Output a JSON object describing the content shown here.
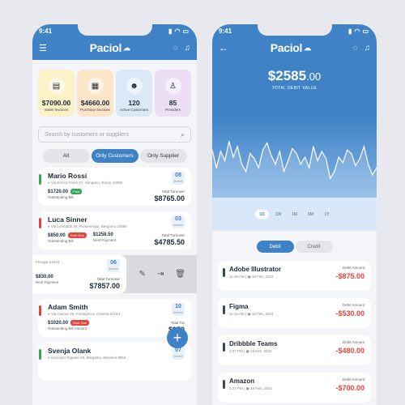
{
  "status_time": "9:41",
  "app_name": "Paciol",
  "tiles": [
    {
      "value": "$7090.00",
      "label": "Sales Invoices",
      "bg": "#fbf2c8"
    },
    {
      "value": "$4660.00",
      "label": "Purchase Invoices",
      "bg": "#fbe4c8"
    },
    {
      "value": "120",
      "label": "Active Customers",
      "bg": "#dbe8f7"
    },
    {
      "value": "85",
      "label": "Providers",
      "bg": "#ecdef5"
    }
  ],
  "search_placeholder": "Search by customers or suppliers",
  "segments": [
    "All",
    "Only Customers",
    "Only Supplier"
  ],
  "customers": [
    {
      "name": "Mario Rossi",
      "addr": "Via Enrico Fermi 67, Sangano, Torino 10090",
      "amount": "$1720.00",
      "status": "Paid",
      "sub": "Outstanding Bill",
      "day": "08",
      "mon": "Invoice",
      "total_label": "Total Turnover",
      "total": "$8765.00"
    },
    {
      "name": "Luca Sinner",
      "addr": "Via Lombardi 38, Pumenengo, Bergamo 24050",
      "amount": "$850.00",
      "status": "Over Due",
      "sub": "Outstanding Bill",
      "amount2": "$1258.50",
      "sub2": "Next Payment",
      "day": "03",
      "mon": "Invoice",
      "total_label": "Total Turnover",
      "total": "$4785.50"
    },
    {
      "addr": "Perugia 61033",
      "amount": "$830.00",
      "sub": "Next Payment",
      "day": "06",
      "mon": "Invoice",
      "total_label": "Total Turnover",
      "total": "$7857.00"
    },
    {
      "name": "Adam Smith",
      "addr": "Via Cavour 25, Fontegreca, Caserta 81014",
      "amount": "$1020.00",
      "status": "Over Due",
      "sub": "Outstanding Bill Amount",
      "day": "10",
      "mon": "Invoice",
      "total_label": "Total Tur",
      "total": "$970"
    },
    {
      "name": "Svenja Olank",
      "addr": "Giacomo Gigante 58, Bergamo, Messina 9864",
      "day": "07",
      "mon": "Invoice"
    }
  ],
  "debit": {
    "amount": "$2585",
    "cents": ".00",
    "label": "TOTAL DEBIT VALUE"
  },
  "chart_data": {
    "type": "line",
    "title": "",
    "x": [
      0,
      1,
      2,
      3,
      4,
      5,
      6,
      7,
      8,
      9,
      10,
      11,
      12,
      13,
      14,
      15,
      16,
      17,
      18,
      19,
      20,
      21,
      22,
      23,
      24,
      25,
      26,
      27,
      28,
      29,
      30,
      31,
      32,
      33,
      34,
      35,
      36,
      37,
      38,
      39
    ],
    "series": [
      {
        "values": [
          60,
          35,
          58,
          45,
          72,
          50,
          65,
          40,
          30,
          55,
          48,
          35,
          60,
          70,
          52,
          40,
          58,
          30,
          45,
          62,
          55,
          40,
          50,
          35,
          65,
          45,
          58,
          48,
          20,
          30,
          50,
          42,
          60,
          55,
          38,
          48,
          65,
          40,
          25,
          35
        ]
      }
    ],
    "ylim": [
      0,
      100
    ],
    "grid": false,
    "legend": "none"
  },
  "ranges": [
    "1D",
    "1W",
    "1M",
    "6M",
    "1Y"
  ],
  "tx_tabs": [
    "Debit",
    "Credit"
  ],
  "transactions": [
    {
      "name": "Adobe Illustrator",
      "time": "11:15 AM",
      "date": "18 Feb, 2023",
      "label": "Debit Amount",
      "amount": "-$875.00"
    },
    {
      "name": "Figma",
      "time": "11:15 AM",
      "date": "18 Feb, 2023",
      "label": "Debit Amount",
      "amount": "-$530.00"
    },
    {
      "name": "Dribbble Teams",
      "time": "2:37 PM",
      "date": "18 Feb, 2023",
      "label": "Debit Amount",
      "amount": "-$480.00"
    },
    {
      "name": "Amazon",
      "time": "2:37 PM",
      "date": "18 Feb, 2023",
      "label": "Debit Amount",
      "amount": "-$700.00"
    }
  ]
}
